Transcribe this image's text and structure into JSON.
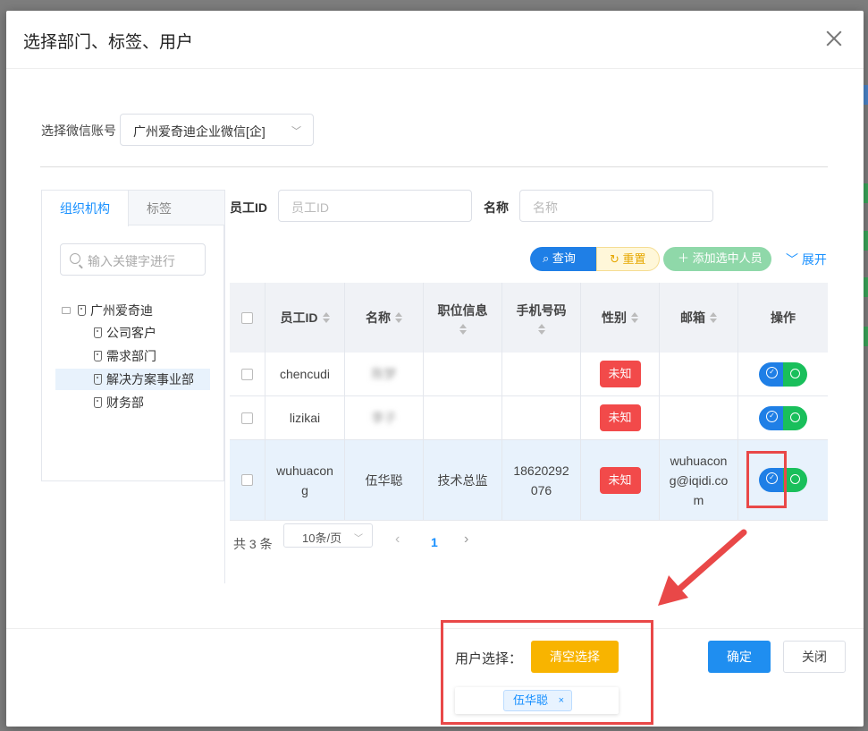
{
  "dialog": {
    "title": "选择部门、标签、用户",
    "close_label": "×"
  },
  "account": {
    "label": "选择微信账号",
    "value": "广州爱奇迪企业微信[企]"
  },
  "tree": {
    "tabs": [
      "组织机构",
      "标签"
    ],
    "active_tab": "组织机构",
    "search_placeholder": "输入关键字进行",
    "root": "广州爱奇迪",
    "children": [
      "公司客户",
      "需求部门",
      "解决方案事业部",
      "财务部"
    ],
    "selected": "解决方案事业部"
  },
  "filters": {
    "id_label": "员工ID",
    "id_placeholder": "员工ID",
    "name_label": "名称",
    "name_placeholder": "名称"
  },
  "toolbar": {
    "query": "查询",
    "reset": "重置",
    "add": "添加选中人员",
    "expand": "展开"
  },
  "table": {
    "headers": [
      "员工ID",
      "名称",
      "职位信息",
      "手机号码",
      "性别",
      "邮箱",
      "操作"
    ],
    "rows": [
      {
        "id": "chencudi",
        "name": "陈梦",
        "position": "",
        "phone": "",
        "gender": "未知",
        "email": ""
      },
      {
        "id": "lizikai",
        "name": "李子",
        "position": "",
        "phone": "",
        "gender": "未知",
        "email": ""
      },
      {
        "id": "wuhuacong",
        "name": "伍华聪",
        "position": "技术总监",
        "phone": "18620292076",
        "gender": "未知",
        "email": "wuhuacong@iqidi.com"
      }
    ]
  },
  "pager": {
    "total": "共 3 条",
    "page_size": "10条/页",
    "current_page": "1",
    "prev": "‹",
    "next": "›"
  },
  "footer": {
    "user_select_label": "用户选择：",
    "clear_label": "清空选择",
    "selected_user": "伍华聪",
    "remove_label": "×",
    "ok_label": "确定",
    "close_label": "关闭"
  },
  "colors": {
    "primary": "#1f7fe6",
    "success": "#19bf5b",
    "warning": "#f8b400",
    "danger": "#f24a4a",
    "annotation": "#e94848"
  }
}
